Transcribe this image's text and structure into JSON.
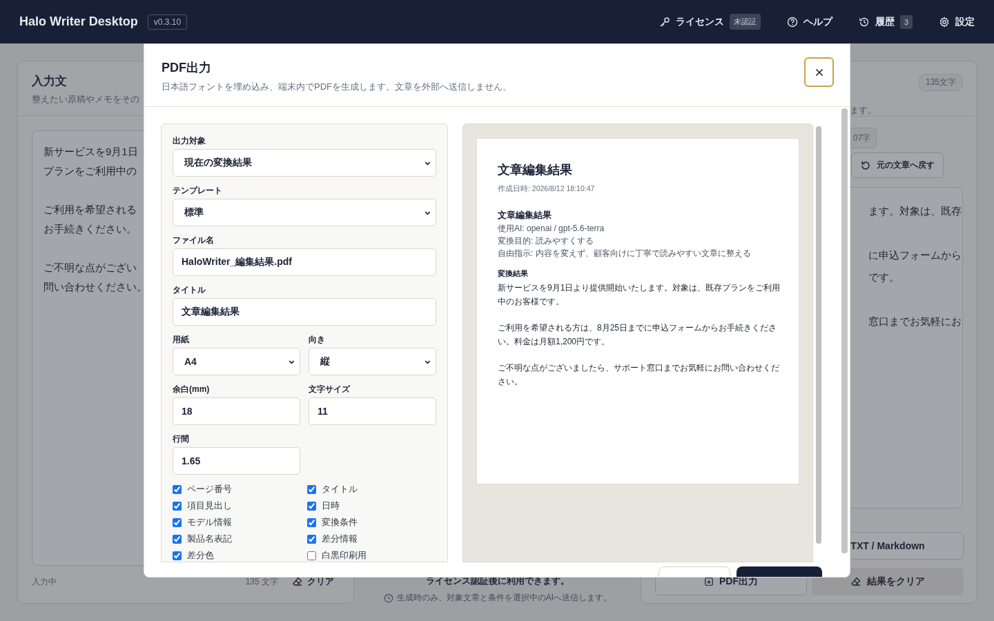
{
  "header": {
    "app_title": "Halo Writer Desktop",
    "version": "v0.3.10",
    "nav": [
      {
        "kind": "license",
        "label": "ライセンス",
        "badge": "未認証"
      },
      {
        "kind": "help",
        "label": "ヘルプ"
      },
      {
        "kind": "history",
        "label": "履歴",
        "badge": "3"
      },
      {
        "kind": "settings",
        "label": "設定"
      }
    ]
  },
  "input_panel": {
    "title": "入力文",
    "subtitle": "整えたい原稿やメモをその",
    "paragraphs": [
      [
        "新サービスを9月1日",
        "プランをご利用中の"
      ],
      [
        "ご利用を希望される",
        "お手続きください。"
      ],
      [
        "ご不明な点がござい",
        "問い合わせください。"
      ]
    ],
    "status": "入力中",
    "count": "135 文字",
    "clear_button": "クリア"
  },
  "middle_panel": {
    "notice": "ライセンス認証後に利用できます。",
    "privacy_note": "生成時のみ、対象文章と条件を選択中のAIへ送信します。"
  },
  "result_panel": {
    "count_badge": "135文字",
    "subtitle": "ます。",
    "result_badge": "07字",
    "revert_button": "元の文章へ戻す",
    "lines": [
      [
        "ます。対象は、既存"
      ],
      [
        "に申込フォームから",
        "です。"
      ],
      [
        "窓口までお気軽にお"
      ]
    ],
    "buttons": [
      {
        "kind": "text",
        "label": "TXT / Markdown"
      },
      {
        "kind": "pdf",
        "label": "PDF出力"
      },
      {
        "kind": "clear",
        "label": "結果をクリア"
      }
    ]
  },
  "pdf_dialog": {
    "title": "PDF出力",
    "subtitle": "日本語フォントを埋め込み、端末内でPDFを生成します。文章を外部へ送信しません。",
    "fields": [
      {
        "kind": "select",
        "label": "出力対象",
        "value": "現在の変換結果"
      },
      {
        "kind": "select",
        "label": "テンプレート",
        "value": "標準"
      },
      {
        "kind": "input",
        "label": "ファイル名",
        "value": "HaloWriter_編集結果.pdf"
      },
      {
        "kind": "input",
        "label": "タイトル",
        "value": "文章編集結果"
      },
      {
        "kind": "select",
        "label": "用紙",
        "value": "A4"
      },
      {
        "kind": "select",
        "label": "向き",
        "value": "縦"
      },
      {
        "kind": "input",
        "label": "余白(mm)",
        "value": "18"
      },
      {
        "kind": "input",
        "label": "文字サイズ",
        "value": "11"
      },
      {
        "kind": "input",
        "label": "行間",
        "value": "1.65"
      }
    ],
    "options": [
      {
        "label": "ページ番号",
        "checked": true
      },
      {
        "label": "タイトル",
        "checked": true
      },
      {
        "label": "項目見出し",
        "checked": true
      },
      {
        "label": "日時",
        "checked": true
      },
      {
        "label": "モデル情報",
        "checked": true
      },
      {
        "label": "変換条件",
        "checked": true
      },
      {
        "label": "製品名表記",
        "checked": true
      },
      {
        "label": "差分情報",
        "checked": true
      },
      {
        "label": "差分色",
        "checked": true
      },
      {
        "label": "白黒印刷用",
        "checked": false
      }
    ],
    "preview": {
      "title": "文章編集結果",
      "created": "作成日時: 2026/8/12 18:10:47",
      "heading": "文章編集結果",
      "meta": [
        "使用AI: openai / gpt-5.6-terra",
        "変換目的: 読みやすくする",
        "自由指示: 内容を変えず、顧客向けに丁寧で読みやすい文章に整える"
      ],
      "section": "変換結果",
      "paragraphs": [
        "新サービスを9月1日より提供開始いたします。対象は、既存プランをご利用中のお客様です。",
        "ご利用を希望される方は、8月25日までに申込フォームからお手続きください。料金は月額1,200円です。",
        "ご不明な点がございましたら、サポート窓口までお気軽にお問い合わせください。"
      ]
    }
  }
}
